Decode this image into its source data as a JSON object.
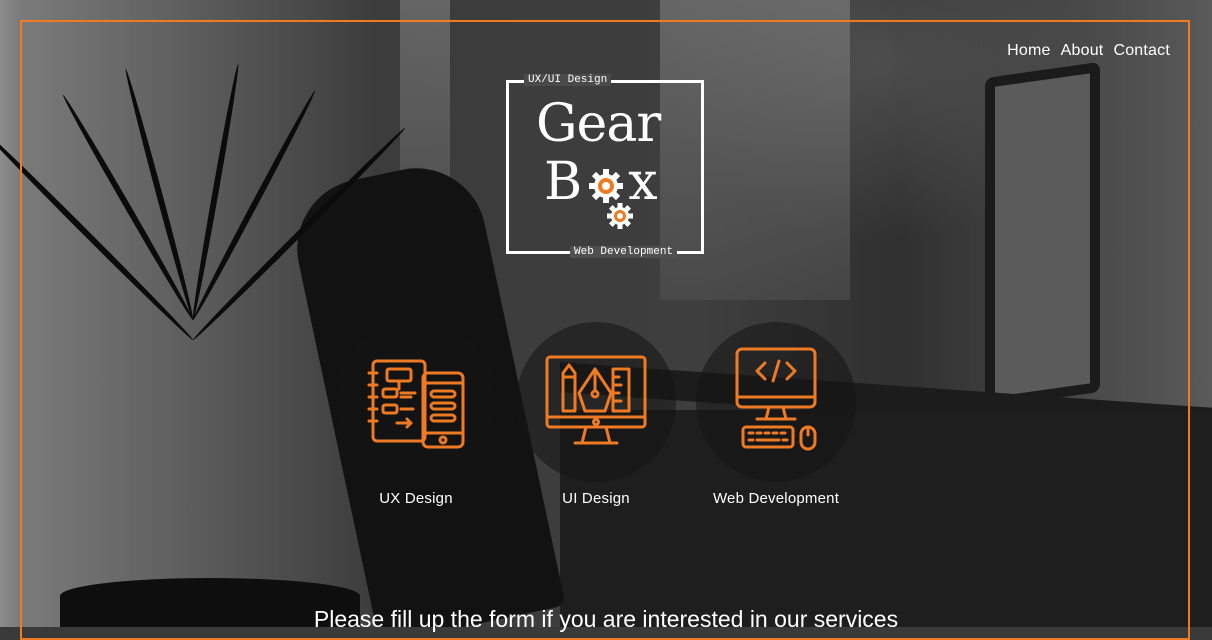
{
  "nav": {
    "items": [
      {
        "label": "Home"
      },
      {
        "label": "About"
      },
      {
        "label": "Contact"
      }
    ]
  },
  "logo": {
    "top_tag": "UX/UI Design",
    "word1": "Gear",
    "word2_first": "B",
    "word2_last": "x",
    "bottom_tag": "Web Development"
  },
  "services": [
    {
      "label": "UX  Design",
      "icon": "ux-design-icon"
    },
    {
      "label": "UI  Design",
      "icon": "ui-design-icon"
    },
    {
      "label": "Web  Development",
      "icon": "web-development-icon"
    }
  ],
  "cta": {
    "text": "Please fill up the form if you are interested in our services"
  },
  "colors": {
    "accent": "#ee7a23",
    "text": "#ffffff"
  }
}
